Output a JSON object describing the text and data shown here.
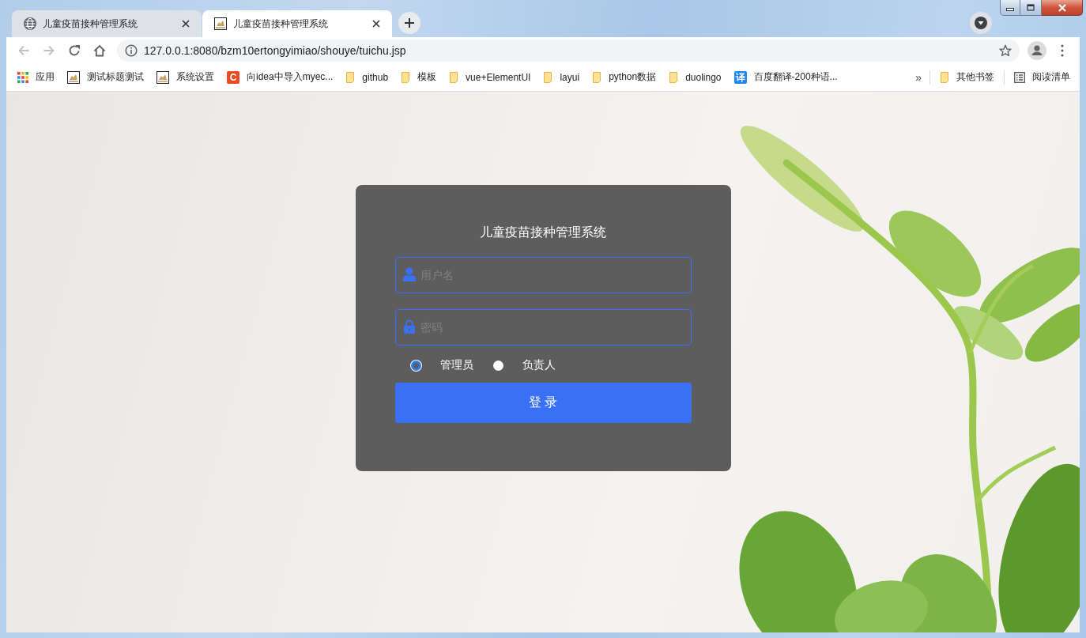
{
  "browser": {
    "tabs": [
      {
        "kind": "globe",
        "title": "儿童疫苗接种管理系统",
        "selected": false
      },
      {
        "kind": "picture",
        "title": "儿童疫苗接种管理系统",
        "selected": true
      }
    ],
    "navigation": {
      "back_disabled": true,
      "forward_disabled": true
    },
    "address_bar": {
      "url": "127.0.0.1:8080/bzm10ertongyimiao/shouye/tuichu.jsp"
    },
    "bookmarks": [
      {
        "kind": "apps",
        "label": "应用"
      },
      {
        "kind": "picture",
        "label": "测试标题测试"
      },
      {
        "kind": "picture",
        "label": "系统设置"
      },
      {
        "kind": "letter",
        "icon_text": "C",
        "color": "#f04a23",
        "label": "向idea中导入myec..."
      },
      {
        "kind": "folder",
        "label": "github"
      },
      {
        "kind": "folder",
        "label": "模板"
      },
      {
        "kind": "folder",
        "label": "vue+ElementUI"
      },
      {
        "kind": "folder",
        "label": "layui"
      },
      {
        "kind": "folder",
        "label": "python数据"
      },
      {
        "kind": "folder",
        "label": "duolingo"
      },
      {
        "kind": "letter",
        "icon_text": "译",
        "color": "#1e88f5",
        "label": "百度翻译-200种语..."
      }
    ],
    "overflow": "»",
    "other_bookmarks": {
      "kind": "folder",
      "label": "其他书签"
    },
    "reading_list": {
      "label": "阅读清单"
    }
  },
  "login": {
    "title": "儿童疫苗接种管理系统",
    "fields": [
      {
        "kind": "user",
        "placeholder": "用户名"
      },
      {
        "kind": "password",
        "placeholder": "密码"
      }
    ],
    "roles": [
      {
        "label": "管理员",
        "selected": true
      },
      {
        "label": "负责人",
        "selected": false
      }
    ],
    "submit": "登 录"
  }
}
